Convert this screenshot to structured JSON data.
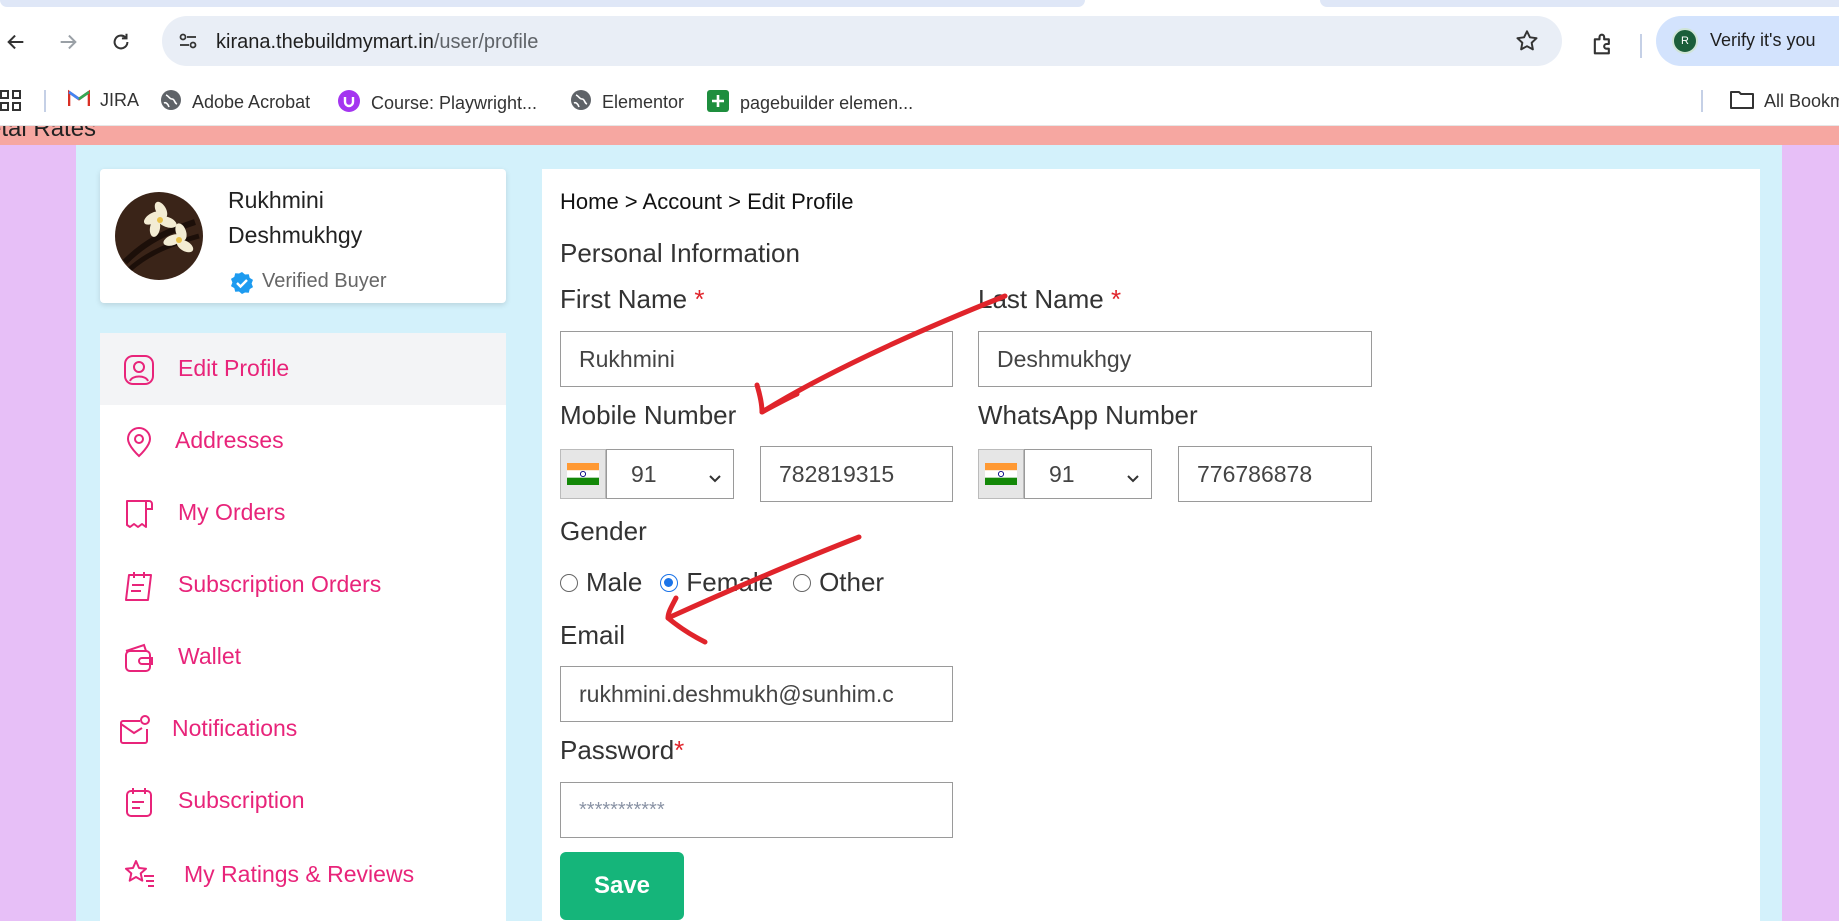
{
  "browser": {
    "url_host": "kirana.thebuildmymart.in",
    "url_path": "/user/profile",
    "profile_label": "Verify it's you",
    "profile_initial": "R",
    "bookmarks": [
      {
        "label": "JIRA",
        "icon": "gmail-icon"
      },
      {
        "label": "Adobe Acrobat",
        "icon": "globe-icon"
      },
      {
        "label": "Course: Playwright...",
        "icon": "udemy-icon"
      },
      {
        "label": "Elementor",
        "icon": "globe-icon"
      },
      {
        "label": "pagebuilder elemen...",
        "icon": "sheets-icon"
      }
    ],
    "all_bookmarks_label": "All Bookm"
  },
  "page": {
    "top_strip_text": "etal Rates"
  },
  "profile": {
    "first_line": "Rukhmini",
    "second_line": "Deshmukhgy",
    "verified_label": "Verified Buyer"
  },
  "menu": [
    {
      "label": "Edit Profile",
      "icon": "user-profile-icon",
      "active": true
    },
    {
      "label": "Addresses",
      "icon": "location-pin-icon"
    },
    {
      "label": "My Orders",
      "icon": "orders-icon"
    },
    {
      "label": "Subscription Orders",
      "icon": "subscription-orders-icon"
    },
    {
      "label": "Wallet",
      "icon": "wallet-icon"
    },
    {
      "label": "Notifications",
      "icon": "notification-mail-icon"
    },
    {
      "label": "Subscription",
      "icon": "subscription-icon"
    },
    {
      "label": "My Ratings & Reviews",
      "icon": "ratings-star-icon"
    }
  ],
  "form": {
    "breadcrumb": "Home > Account > Edit Profile",
    "section_title": "Personal Information",
    "first_name_label": "First Name",
    "first_name_value": "Rukhmini",
    "last_name_label": "Last Name",
    "last_name_value": "Deshmukhgy",
    "required_mark": "*",
    "mobile_label": "Mobile Number",
    "mobile_code": "91",
    "mobile_value": "782819315",
    "whatsapp_label": "WhatsApp Number",
    "whatsapp_code": "91",
    "whatsapp_value": "776786878",
    "gender_label": "Gender",
    "gender_options": [
      "Male",
      "Female",
      "Other"
    ],
    "gender_selected": "Female",
    "email_label": "Email",
    "email_value": "rukhmini.deshmukh@sunhim.c",
    "password_label": "Password",
    "password_placeholder": "***********",
    "save_label": "Save"
  },
  "colors": {
    "accent": "#e8247a",
    "save": "#15b57a",
    "page_bg": "#e7bff7",
    "main_bg": "#d3f1fb",
    "annotation": "#e0242b"
  }
}
